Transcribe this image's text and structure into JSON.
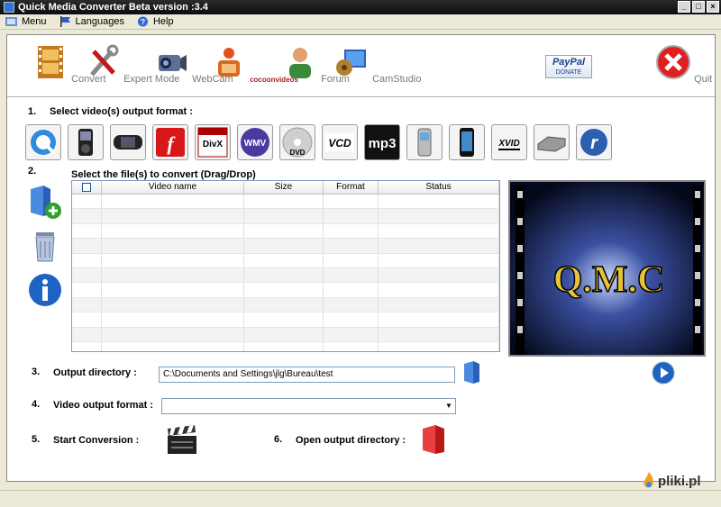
{
  "window": {
    "title": "Quick Media Converter   Beta version :3.4"
  },
  "menu": {
    "items": [
      {
        "label": "Menu"
      },
      {
        "label": "Languages"
      },
      {
        "label": "Help"
      }
    ]
  },
  "toolbar": {
    "convert": "Convert",
    "expert_mode": "Expert Mode",
    "webcam": "WebCam",
    "cocoon": "cocoonvideos",
    "forum": "Forum",
    "camstudio": "CamStudio",
    "paypal_line1": "PayPal",
    "paypal_line2": "DONATE",
    "quit": "Quit"
  },
  "steps": {
    "s1": {
      "num": "1.",
      "label": "Select video(s) output format :"
    },
    "s2": {
      "num": "2.",
      "label": "Select the file(s) to convert (Drag/Drop)"
    },
    "s3": {
      "num": "3.",
      "label": "Output directory :"
    },
    "s4": {
      "num": "4.",
      "label": "Video output format :"
    },
    "s5": {
      "num": "5.",
      "label": "Start Conversion :"
    },
    "s6": {
      "num": "6.",
      "label": "Open output directory :"
    }
  },
  "formats": [
    {
      "name": "quicktime",
      "text": "Q"
    },
    {
      "name": "ipod",
      "text": ""
    },
    {
      "name": "psp",
      "text": ""
    },
    {
      "name": "flash",
      "text": "F"
    },
    {
      "name": "divx",
      "text": "DivX"
    },
    {
      "name": "wmv",
      "text": "WMV"
    },
    {
      "name": "dvd",
      "text": "DVD"
    },
    {
      "name": "vcd",
      "text": "VCD"
    },
    {
      "name": "mp3",
      "text": "mp3"
    },
    {
      "name": "mobile",
      "text": ""
    },
    {
      "name": "iphone",
      "text": ""
    },
    {
      "name": "xvid",
      "text": "XVID"
    },
    {
      "name": "dvd-player",
      "text": ""
    },
    {
      "name": "realplayer",
      "text": "r"
    }
  ],
  "table": {
    "headers": [
      "",
      "Video name",
      "Size",
      "Format",
      "Status"
    ],
    "rows": 11
  },
  "preview": {
    "logo_text": "Q.M.C"
  },
  "output_directory": {
    "value": "C:\\Documents and Settings\\jlg\\Bureau\\test"
  },
  "video_output_format": {
    "value": ""
  },
  "watermark": {
    "text": "pliki.pl"
  },
  "colors": {
    "accent": "#1e62c2",
    "quit": "#e02020",
    "preview_text": "#e8c23a"
  }
}
